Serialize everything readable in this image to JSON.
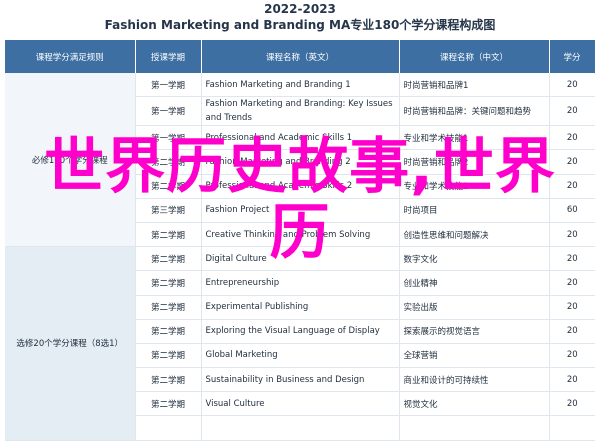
{
  "header": {
    "year": "2022-2023",
    "title": "Fashion Marketing and Branding MA专业180个学分课程构成图"
  },
  "columns": [
    "课程学分满足规则",
    "授课学期",
    "课程名称（英文）",
    "课程名称（中文）",
    "学分"
  ],
  "groups": [
    {
      "label": "必修160个学分课程",
      "rows": 7
    },
    {
      "label": "选修20个学分课程（8选1）",
      "rows": 8
    }
  ],
  "rows": [
    {
      "term": "第一学期",
      "en": "Fashion Marketing and Branding 1",
      "zh": "时尚营销和品牌1",
      "credits": "20"
    },
    {
      "term": "第一学期",
      "en": "Fashion Marketing and Branding: Key Issues and Trends",
      "zh": "时尚营销和品牌：关键问题和趋势",
      "credits": "20"
    },
    {
      "term": "第一学期",
      "en": "Professional and Academic Skills 1",
      "zh": "专业和学术技能1",
      "credits": "20"
    },
    {
      "term": "第二学期",
      "en": "Fashion Marketing and Branding 2",
      "zh": "时尚营销和品牌2",
      "credits": "20"
    },
    {
      "term": "第二学期",
      "en": "Professional and Academic Skills 2",
      "zh": "专业和学术技能2",
      "credits": "20"
    },
    {
      "term": "第三学期",
      "en": "Fashion Project",
      "zh": "时尚项目",
      "credits": "60"
    },
    {
      "term": "第二学期",
      "en": "Creative Thinking and Problem Solving",
      "zh": "创造性思维和问题解决",
      "credits": "20"
    },
    {
      "term": "第二学期",
      "en": "Digital Culture",
      "zh": "数字文化",
      "credits": "20"
    },
    {
      "term": "第二学期",
      "en": "Entrepreneurship",
      "zh": "创业精神",
      "credits": "20"
    },
    {
      "term": "第二学期",
      "en": "Experimental Publishing",
      "zh": "实验出版",
      "credits": "20"
    },
    {
      "term": "第二学期",
      "en": "Exploring the Visual Language of Display",
      "zh": "探索展示的视觉语言",
      "credits": "20"
    },
    {
      "term": "第二学期",
      "en": "Global Marketing",
      "zh": "全球营销",
      "credits": "20"
    },
    {
      "term": "第二学期",
      "en": "Sustainability in Business and Design",
      "zh": "商业和设计的可持续性",
      "credits": "20"
    },
    {
      "term": "第二学期",
      "en": "Visual Culture",
      "zh": "视觉文化",
      "credits": "20"
    }
  ],
  "overlay_text": "世界历史故事,世界历",
  "colors": {
    "header_bg": "#3d6fa3",
    "overlay": "#ff00cc"
  }
}
